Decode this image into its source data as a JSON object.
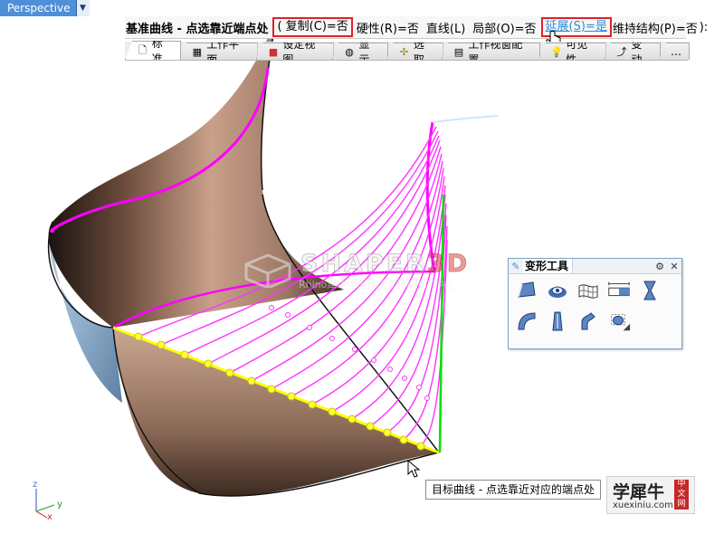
{
  "viewport": {
    "title": "Perspective",
    "dropdown_glyph": "▼"
  },
  "command": {
    "prompt": "基准曲线 - 点选靠近端点处",
    "open_paren": "(",
    "copy_option": "复制(C)=否",
    "rigid_option": "硬性(R)=否",
    "line_option": "直线(L)",
    "local_option": "局部(O)=否",
    "extend_option": "延展(S)=是",
    "preserve_option": "维持结构(P)=否",
    "end": "):"
  },
  "tabs": [
    {
      "label": "标准",
      "icon": "document-icon"
    },
    {
      "label": "工作平面",
      "icon": "grid-icon"
    },
    {
      "label": "设定视图",
      "icon": "view-icon"
    },
    {
      "label": "显示",
      "icon": "sphere-icon"
    },
    {
      "label": "选取",
      "icon": "select-icon"
    },
    {
      "label": "工作视窗配置",
      "icon": "layout-icon"
    },
    {
      "label": "可见性",
      "icon": "bulb-icon"
    },
    {
      "label": "变动",
      "icon": "transform-icon"
    },
    {
      "label": "…",
      "icon": "more-icon"
    }
  ],
  "panel": {
    "title": "变形工具",
    "icons": [
      "cage-edit-icon",
      "maelstrom-icon",
      "twist-icon",
      "stretch-icon",
      "taper-icon",
      "bend-icon",
      "flow-icon",
      "smash-icon",
      "flow-along-surface-icon"
    ]
  },
  "tooltip": {
    "text": "目标曲线 - 点选靠近对应的端点处"
  },
  "axes": {
    "z": "z",
    "y": "y",
    "x": "x"
  },
  "watermark": {
    "brand_a": "SHAPER",
    "brand_b": "3D",
    "subtitle": "Rhino犀牛中国技术支持&推广中心"
  },
  "logo": {
    "main": "学犀牛",
    "url": "xuexiniu.com",
    "badge": "中文网"
  },
  "colors": {
    "accent": "#4d8fd8",
    "highlight": "#e0202a",
    "curve_magenta": "#ff00ff",
    "curve_yellow": "#ffff00",
    "curve_green": "#00e000"
  }
}
